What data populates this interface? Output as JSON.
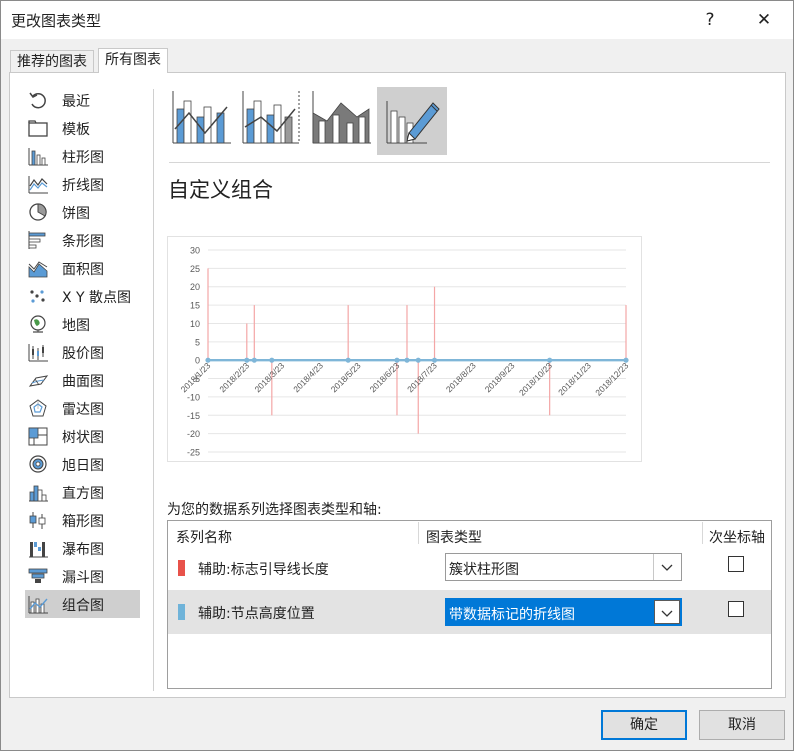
{
  "window": {
    "title": "更改图表类型",
    "help_label": "?",
    "close_label": "✕"
  },
  "tabs": [
    {
      "label": "推荐的图表",
      "active": false
    },
    {
      "label": "所有图表",
      "active": true
    }
  ],
  "sidebar": {
    "items": [
      {
        "label": "最近",
        "icon": "recent-icon"
      },
      {
        "label": "模板",
        "icon": "template-folder-icon"
      },
      {
        "label": "柱形图",
        "icon": "column-chart-icon"
      },
      {
        "label": "折线图",
        "icon": "line-chart-icon"
      },
      {
        "label": "饼图",
        "icon": "pie-chart-icon"
      },
      {
        "label": "条形图",
        "icon": "bar-chart-icon"
      },
      {
        "label": "面积图",
        "icon": "area-chart-icon"
      },
      {
        "label": "X Y 散点图",
        "icon": "scatter-chart-icon"
      },
      {
        "label": "地图",
        "icon": "map-chart-icon"
      },
      {
        "label": "股价图",
        "icon": "stock-chart-icon"
      },
      {
        "label": "曲面图",
        "icon": "surface-chart-icon"
      },
      {
        "label": "雷达图",
        "icon": "radar-chart-icon"
      },
      {
        "label": "树状图",
        "icon": "treemap-chart-icon"
      },
      {
        "label": "旭日图",
        "icon": "sunburst-chart-icon"
      },
      {
        "label": "直方图",
        "icon": "histogram-chart-icon"
      },
      {
        "label": "箱形图",
        "icon": "box-whisker-chart-icon"
      },
      {
        "label": "瀑布图",
        "icon": "waterfall-chart-icon"
      },
      {
        "label": "漏斗图",
        "icon": "funnel-chart-icon"
      },
      {
        "label": "组合图",
        "icon": "combo-chart-icon"
      }
    ],
    "selected_index": 18
  },
  "subtypes": {
    "items": [
      {
        "icon": "clustered-column-line-icon"
      },
      {
        "icon": "clustered-column-line-secondary-axis-icon"
      },
      {
        "icon": "stacked-area-clustered-column-icon"
      },
      {
        "icon": "custom-combination-icon"
      }
    ],
    "selected_index": 3
  },
  "selection_title": "自定义组合",
  "chart_data": {
    "type": "bar",
    "title": "",
    "xlabel": "",
    "ylabel": "",
    "ylim": [
      -25,
      30
    ],
    "yticks": [
      "30",
      "25",
      "20",
      "15",
      "10",
      "5",
      "0",
      "-5",
      "-10",
      "-15",
      "-20",
      "-25"
    ],
    "xticks": [
      "2018/1/23",
      "2018/2/23",
      "2018/3/23",
      "2018/4/23",
      "2018/5/23",
      "2018/6/23",
      "2018/7/23",
      "2018/8/23",
      "2018/9/23",
      "2018/10/23",
      "2018/11/23",
      "2018/12/23"
    ],
    "grid": true,
    "colors": {
      "bars": "#f4a6a6",
      "line": "#7fb6d8",
      "grid": "#e6e6e6",
      "axis": "#cfcfcf"
    },
    "series": [
      {
        "kind": "clustered-column",
        "points": [
          {
            "x": "2018/1/23",
            "y": 25
          },
          {
            "x": "2018/2/23",
            "y": 10
          },
          {
            "x": "2018/3/1",
            "y": 15
          },
          {
            "x": "2018/3/15",
            "y": -15
          },
          {
            "x": "2018/5/15",
            "y": 15
          },
          {
            "x": "2018/6/23",
            "y": -15
          },
          {
            "x": "2018/7/1",
            "y": 15
          },
          {
            "x": "2018/7/10",
            "y": -20
          },
          {
            "x": "2018/7/23",
            "y": 20
          },
          {
            "x": "2018/10/23",
            "y": -15
          },
          {
            "x": "2018/12/23",
            "y": 15
          }
        ]
      },
      {
        "kind": "line-with-markers",
        "points": [
          {
            "x": "2018/1/23",
            "y": 0
          },
          {
            "x": "2018/2/23",
            "y": 0
          },
          {
            "x": "2018/3/1",
            "y": 0
          },
          {
            "x": "2018/3/15",
            "y": 0
          },
          {
            "x": "2018/5/15",
            "y": 0
          },
          {
            "x": "2018/6/23",
            "y": 0
          },
          {
            "x": "2018/7/1",
            "y": 0
          },
          {
            "x": "2018/7/10",
            "y": 0
          },
          {
            "x": "2018/7/23",
            "y": 0
          },
          {
            "x": "2018/10/23",
            "y": 0
          },
          {
            "x": "2018/12/23",
            "y": 0
          }
        ]
      }
    ]
  },
  "series_section": {
    "prompt": "为您的数据系列选择图表类型和轴:",
    "headers": {
      "name": "系列名称",
      "type": "图表类型",
      "secondary": "次坐标轴"
    },
    "rows": [
      {
        "name": "辅助:标志引导线长度",
        "color": "#e8524a",
        "chart_type": "簇状柱形图",
        "secondary_axis": false
      },
      {
        "name": "辅助:节点高度位置",
        "color": "#6fb3d9",
        "chart_type": "带数据标记的折线图",
        "secondary_axis": false
      }
    ]
  },
  "buttons": {
    "ok": "确定",
    "cancel": "取消"
  }
}
